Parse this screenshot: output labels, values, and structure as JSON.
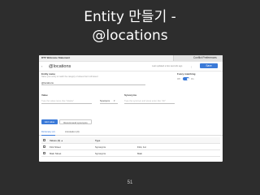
{
  "slide": {
    "title_line1": "Entity 만들기 -",
    "title_line2": "@locations",
    "page_number": "51"
  },
  "app": {
    "breadcrumb": "DTF Welcome Statement",
    "right_tab": "Conflict Preferences",
    "back_glyph": "‹",
    "page_title": "@locations",
    "header_note": "Last updated a few seconds ago",
    "menu_glyph": "⋮",
    "save_label": "Save"
  },
  "form": {
    "entity_name_label": "Entity name",
    "entity_name_hint": "Name your entity to match the category of values that it will detect",
    "entity_name_value": "@locations",
    "fuzzy_label": "Fuzzy matching",
    "fuzzy_off": "Off",
    "fuzzy_on": "On",
    "value_label": "Value",
    "value_placeholder": "Type the value name, like \"Alaska\"",
    "synonyms_dropdown": "Synonyms",
    "synonyms_label": "Synonyms",
    "synonyms_placeholder": "Type the synonym and press enter, like \"AK\""
  },
  "actions": {
    "add_value": "Add value",
    "recommend": "Recommend synonyms"
  },
  "tabs": [
    {
      "label": "Dictionary (2)",
      "active": true
    },
    {
      "label": "Annotation (0)",
      "active": false
    }
  ],
  "table": {
    "headers": [
      "Values (2) ▲",
      "Type"
    ],
    "rows": [
      {
        "value": "First Street",
        "type": "Synonyms",
        "extra": "First, 1st"
      },
      {
        "value": "Main Street",
        "type": "Synonyms",
        "extra": "Main"
      }
    ]
  },
  "colors": {
    "accent": "#3b7ad8",
    "slide_background": "#2d2d2d"
  }
}
